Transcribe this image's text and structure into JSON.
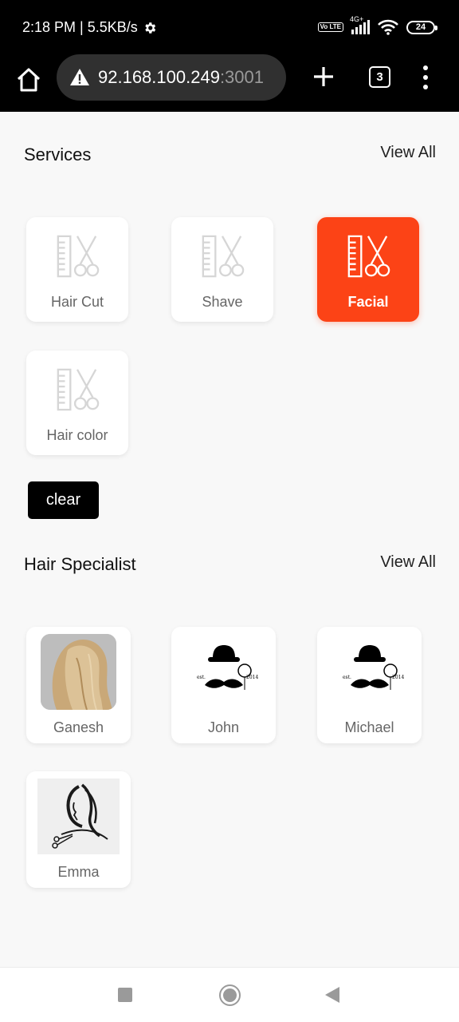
{
  "status_bar": {
    "time_speed": "2:18 PM | 5.5KB/s",
    "settings_icon": "gear-icon",
    "volte": "Vo LTE",
    "network": "4G+",
    "battery": "24"
  },
  "browser": {
    "url_host": "92.168.100.249",
    "url_port": ":3001",
    "tab_count": "3",
    "icons": [
      "home-icon",
      "warning-icon",
      "plus-icon",
      "tabs-icon",
      "more-vert-icon"
    ]
  },
  "services": {
    "title": "Services",
    "view_all": "View All",
    "items": [
      {
        "label": "Hair Cut",
        "active": false
      },
      {
        "label": "Shave",
        "active": false
      },
      {
        "label": "Facial",
        "active": true
      },
      {
        "label": "Hair color",
        "active": false
      }
    ],
    "clear_label": "clear",
    "icon": "comb-scissors-icon",
    "accent_color": "#fc4316"
  },
  "specialists": {
    "title": "Hair Specialist",
    "view_all": "View All",
    "items": [
      {
        "name": "Ganesh",
        "avatar": "hair-photo"
      },
      {
        "name": "John",
        "avatar": "moustache-hat-logo"
      },
      {
        "name": "Michael",
        "avatar": "moustache-hat-logo"
      },
      {
        "name": "Emma",
        "avatar": "woman-silhouette-logo"
      }
    ],
    "logo_text_left": "est.",
    "logo_text_right": "2014"
  },
  "nav_bar": {
    "icons": [
      "recents-square-icon",
      "home-circle-icon",
      "back-triangle-icon"
    ]
  }
}
